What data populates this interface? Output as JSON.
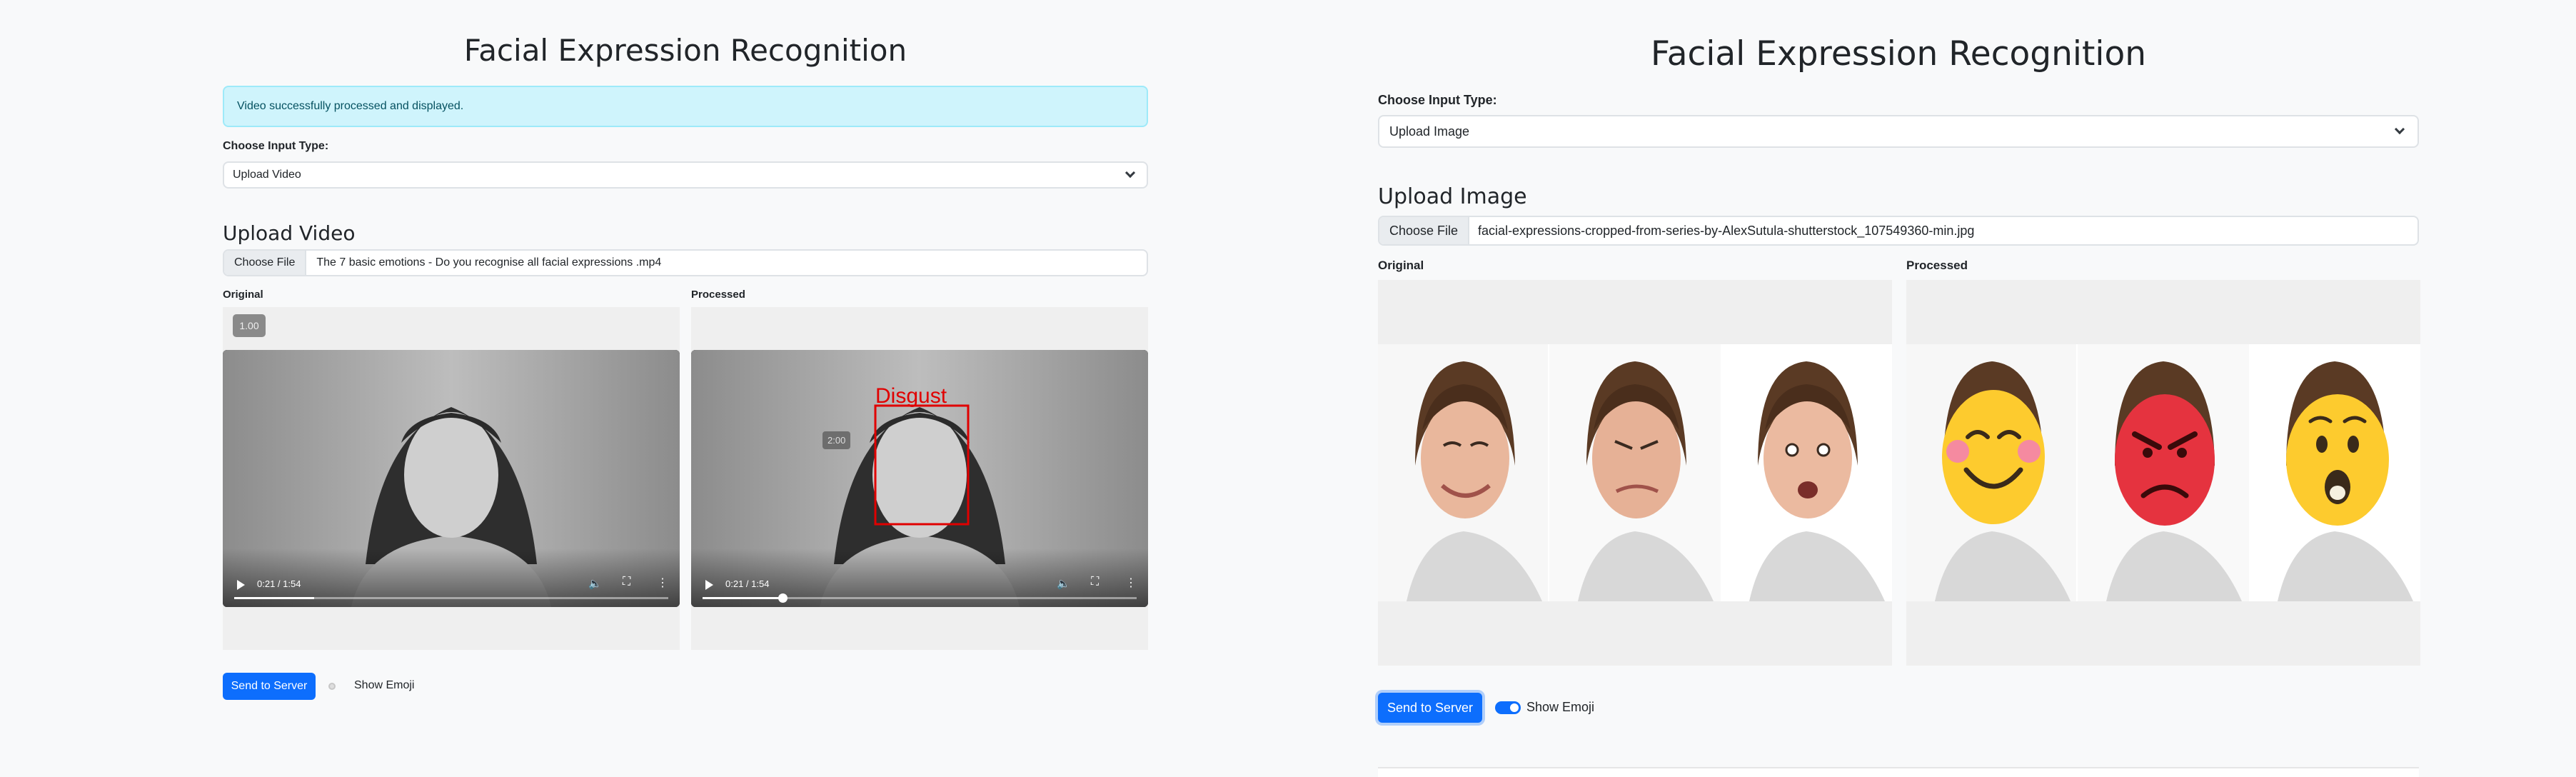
{
  "left": {
    "title": "Facial Expression Recognition",
    "alert": "Video successfully processed and displayed.",
    "input_type_label": "Choose Input Type:",
    "input_type_value": "Upload Video",
    "upload_title": "Upload Video",
    "file_button": "Choose File",
    "file_name": "The 7 basic emotions - Do you recognise all facial expressions .mp4",
    "original_label": "Original",
    "processed_label": "Processed",
    "speed_badge": "1.00",
    "seek_tooltip": "2:00",
    "detection_label": "Disgust",
    "original_time": "0:21 / 1:54",
    "processed_time": "0:21 / 1:54",
    "send_button": "Send to Server",
    "show_emoji_label": "Show Emoji",
    "show_emoji_on": false,
    "original_progress": 0.184,
    "processed_progress": 0.184
  },
  "right": {
    "title": "Facial Expression Recognition",
    "input_type_label": "Choose Input Type:",
    "input_type_value": "Upload Image",
    "upload_title": "Upload Image",
    "file_button": "Choose File",
    "file_name": "facial-expressions-cropped-from-series-by-AlexSutula-shutterstock_107549360-min.jpg",
    "original_label": "Original",
    "processed_label": "Processed",
    "send_button": "Send to Server",
    "show_emoji_label": "Show Emoji",
    "show_emoji_on": true
  },
  "colors": {
    "primary": "#0d6efd",
    "alert_bg": "#cff4fc",
    "detection_box": "#e00000",
    "emoji_yellow": "#fdcb2e",
    "emoji_red": "#e5333f"
  }
}
